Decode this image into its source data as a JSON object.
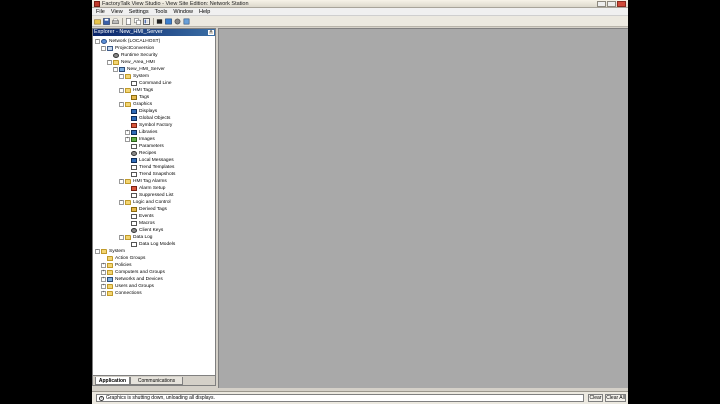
{
  "window": {
    "title": "FactoryTalk View Studio - View Site Edition: Network Station"
  },
  "menu": [
    "File",
    "View",
    "Settings",
    "Tools",
    "Window",
    "Help"
  ],
  "toolbar": {
    "icons": [
      "open-folder-icon",
      "save-icon",
      "print-icon",
      "new-icon",
      "copy-icon",
      "explorer-icon",
      "stop-icon",
      "launch-icon",
      "test-icon",
      "settings-icon"
    ]
  },
  "explorer": {
    "title": "Explorer - New_HMI_Server",
    "tree": [
      {
        "label": "Network (LOCALHOST)",
        "expanded": true
      },
      {
        "label": "ProjectConversion",
        "expanded": true
      },
      {
        "label": "Runtime Security"
      },
      {
        "label": "New_Area_HMI",
        "expanded": true
      },
      {
        "label": "New_HMI_Server",
        "expanded": true
      },
      {
        "label": "System",
        "expanded": true
      },
      {
        "label": "Command Line"
      },
      {
        "label": "HMI Tags",
        "expanded": true
      },
      {
        "label": "Tags"
      },
      {
        "label": "Graphics",
        "expanded": true
      },
      {
        "label": "Displays"
      },
      {
        "label": "Global Objects"
      },
      {
        "label": "Symbol Factory"
      },
      {
        "label": "Libraries"
      },
      {
        "label": "Images"
      },
      {
        "label": "Parameters"
      },
      {
        "label": "Recipes"
      },
      {
        "label": "Local Messages"
      },
      {
        "label": "Trend Templates"
      },
      {
        "label": "Trend Snapshots"
      },
      {
        "label": "HMI Tag Alarms",
        "expanded": true
      },
      {
        "label": "Alarm Setup"
      },
      {
        "label": "Suppressed List"
      },
      {
        "label": "Logic and Control",
        "expanded": true
      },
      {
        "label": "Derived Tags"
      },
      {
        "label": "Events"
      },
      {
        "label": "Macros"
      },
      {
        "label": "Client Keys"
      },
      {
        "label": "Data Log",
        "expanded": true
      },
      {
        "label": "Data Log Models"
      },
      {
        "label": "System",
        "expanded": true
      },
      {
        "label": "Action Groups"
      },
      {
        "label": "Policies"
      },
      {
        "label": "Computers and Groups"
      },
      {
        "label": "Networks and Devices"
      },
      {
        "label": "Users and Groups"
      },
      {
        "label": "Connections"
      }
    ],
    "tabs": [
      "Application",
      "Communications"
    ]
  },
  "status": {
    "message": "Graphics is shutting down, unloading all displays.",
    "clear_label": "Clear",
    "clear_all_label": "Clear All"
  }
}
